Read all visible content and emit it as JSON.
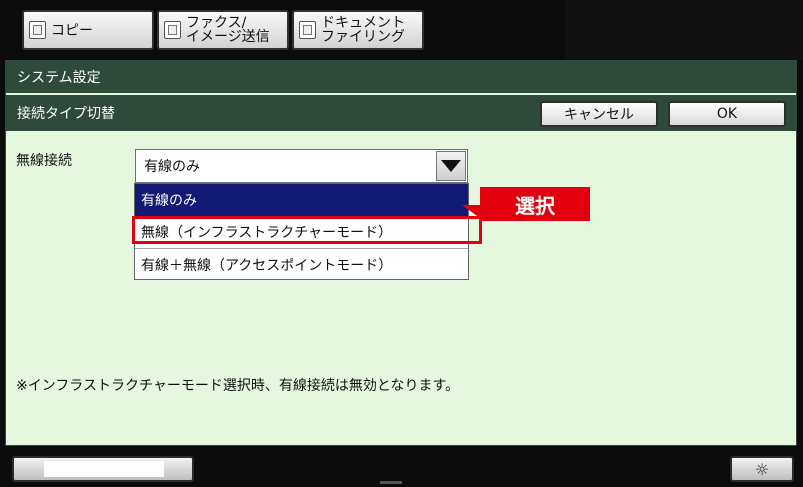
{
  "tabs": [
    {
      "label": "コピー"
    },
    {
      "label_line1": "ファクス/",
      "label_line2": "イメージ送信"
    },
    {
      "label_line1": "ドキュメント",
      "label_line2": "ファイリング"
    }
  ],
  "header": {
    "system_title": "システム設定",
    "section_title": "接続タイプ切替",
    "cancel_label": "キャンセル",
    "ok_label": "OK"
  },
  "form": {
    "field_label": "無線接続",
    "selected_value": "有線のみ",
    "options": [
      {
        "label": "有線のみ"
      },
      {
        "label": "無線（インフラストラクチャーモード）"
      },
      {
        "label": "有線＋無線（アクセスポイントモード）"
      }
    ]
  },
  "callout": {
    "label": "選択"
  },
  "note": "※インフラストラクチャーモード選択時、有線接続は無効となります。",
  "footer": {
    "brightness_glyph": "☼"
  },
  "colors": {
    "highlight": "#e2000f",
    "selected_option": "#121a74",
    "bar": "#2f4a3a",
    "panel": "#e6f7df"
  }
}
